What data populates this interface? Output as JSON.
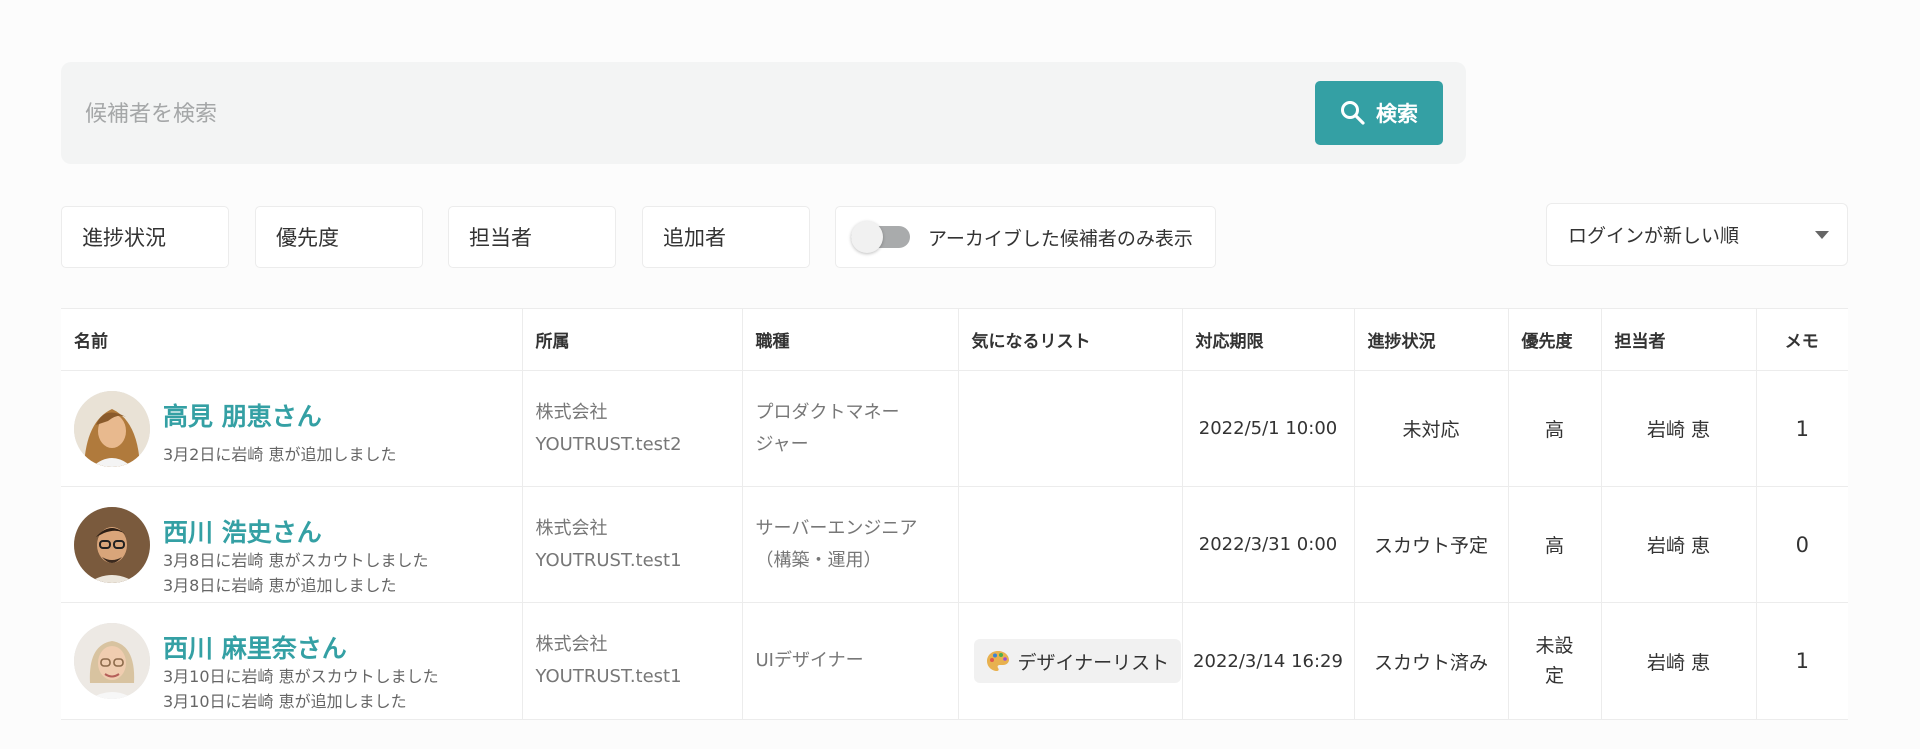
{
  "search": {
    "placeholder": "候補者を検索",
    "button_label": "検索"
  },
  "filters": {
    "progress": "進捗状況",
    "priority": "優先度",
    "assignee": "担当者",
    "adder": "追加者",
    "archive_toggle_label": "アーカイブした候補者のみ表示",
    "archive_toggle_on": false
  },
  "sort": {
    "selected": "ログインが新しい順"
  },
  "colors": {
    "accent": "#34a0a4",
    "toggle_off": "#a9abac"
  },
  "table": {
    "headers": [
      "名前",
      "所属",
      "職種",
      "気になるリスト",
      "対応期限",
      "進捗状況",
      "優先度",
      "担当者",
      "メモ"
    ],
    "rows": [
      {
        "name": "高見 朋恵さん",
        "activity": [
          "3月2日に岩崎 恵が追加しました"
        ],
        "company": [
          "株式会社",
          "YOUTRUST.test2"
        ],
        "job": [
          "プロダクトマネー",
          "ジャー"
        ],
        "list": "",
        "deadline": "2022/5/1 10:00",
        "status": "未対応",
        "priority": [
          "高"
        ],
        "assignee": "岩崎 恵",
        "memo": "1"
      },
      {
        "name": "西川 浩史さん",
        "activity": [
          "3月8日に岩崎 恵がスカウトしました",
          "3月8日に岩崎 恵が追加しました"
        ],
        "company": [
          "株式会社",
          "YOUTRUST.test1"
        ],
        "job": [
          "サーバーエンジニア",
          "（構築・運用）"
        ],
        "list": "",
        "deadline": "2022/3/31 0:00",
        "status": "スカウト予定",
        "priority": [
          "高"
        ],
        "assignee": "岩崎 恵",
        "memo": "0"
      },
      {
        "name": "西川 麻里奈さん",
        "activity": [
          "3月10日に岩崎 恵がスカウトしました",
          "3月10日に岩崎 恵が追加しました"
        ],
        "company": [
          "株式会社",
          "YOUTRUST.test1"
        ],
        "job": [
          "UIデザイナー"
        ],
        "list": "デザイナーリスト",
        "list_icon": "palette-icon",
        "deadline": "2022/3/14 16:29",
        "status": "スカウト済み",
        "priority": [
          "未設",
          "定"
        ],
        "assignee": "岩崎 恵",
        "memo": "1"
      }
    ]
  }
}
